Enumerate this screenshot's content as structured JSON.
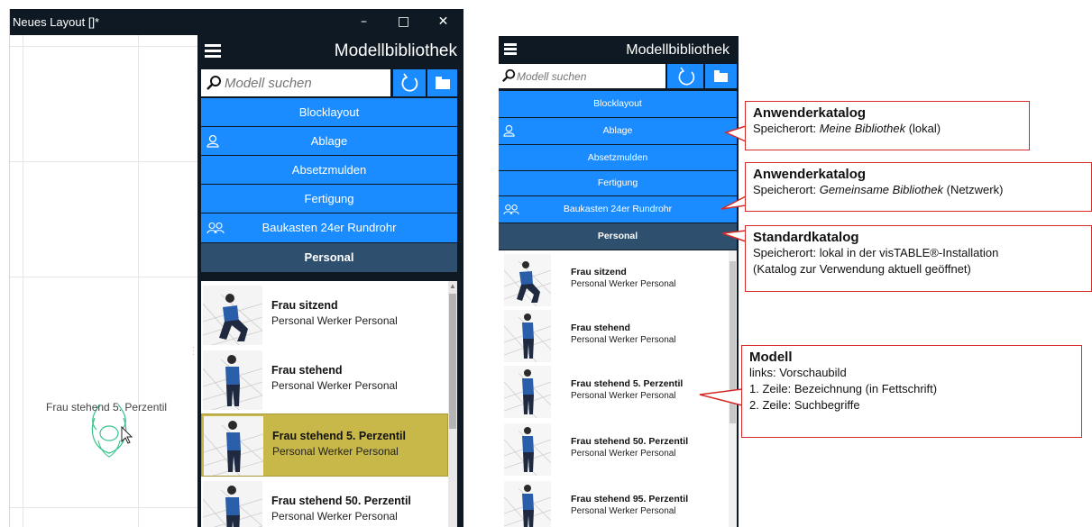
{
  "window": {
    "title": "Neues Layout []*",
    "minimize_glyph": "–",
    "maximize_glyph": "□",
    "close_glyph": "✕"
  },
  "canvas": {
    "model_label": "Frau stehend 5. Perzentil"
  },
  "library": {
    "title": "Modellbibliothek",
    "search_placeholder": "Modell suchen",
    "refresh_icon": "refresh-icon",
    "folder_icon": "folder-icon",
    "categories": [
      {
        "label": "Blocklayout",
        "icon": ""
      },
      {
        "label": "Ablage",
        "icon": "user-icon"
      },
      {
        "label": "Absetzmulden",
        "icon": ""
      },
      {
        "label": "Fertigung",
        "icon": ""
      },
      {
        "label": "Baukasten 24er Rundrohr",
        "icon": "users-icon"
      },
      {
        "label": "Personal",
        "icon": "",
        "active": true
      }
    ],
    "items": [
      {
        "name": "Frau sitzend",
        "tags": "Personal Werker Personal"
      },
      {
        "name": "Frau stehend",
        "tags": "Personal Werker Personal"
      },
      {
        "name": "Frau stehend 5. Perzentil",
        "tags": "Personal Werker Personal",
        "selected": true
      },
      {
        "name": "Frau stehend 50. Perzentil",
        "tags": "Personal Werker Personal"
      }
    ],
    "items_right": [
      {
        "name": "Frau sitzend",
        "tags": "Personal Werker Personal"
      },
      {
        "name": "Frau stehend",
        "tags": "Personal Werker Personal"
      },
      {
        "name": "Frau stehend 5. Perzentil",
        "tags": "Personal Werker Personal"
      },
      {
        "name": "Frau stehend 50. Perzentil",
        "tags": "Personal Werker Personal"
      },
      {
        "name": "Frau stehend 95. Perzentil",
        "tags": "Personal Werker Personal"
      }
    ]
  },
  "callouts": [
    {
      "heading": "Anwenderkatalog",
      "line1_prefix": "Speicherort: ",
      "line1_em": "Meine Bibliothek",
      "line1_suffix": " (lokal)"
    },
    {
      "heading": "Anwenderkatalog",
      "line1_prefix": "Speicherort: ",
      "line1_em": "Gemeinsame Bibliothek",
      "line1_suffix": " (Netzwerk)"
    },
    {
      "heading": "Standardkatalog",
      "line1": "Speicherort: lokal in der visTABLE®-Installation",
      "line2": "(Katalog zur Verwendung aktuell geöffnet)"
    },
    {
      "heading": "Modell",
      "line1": "links: Vorschaubild",
      "line2": "1. Zeile: Bezeichnung  (in Fettschrift)",
      "line3": "2. Zeile: Suchbegriffe"
    }
  ],
  "colors": {
    "accent_blue": "#1a8cff",
    "dark_header": "#0f1923",
    "active_category": "#2e4f6e",
    "selection": "#c8b84a",
    "callout_border": "#d42a2a"
  }
}
